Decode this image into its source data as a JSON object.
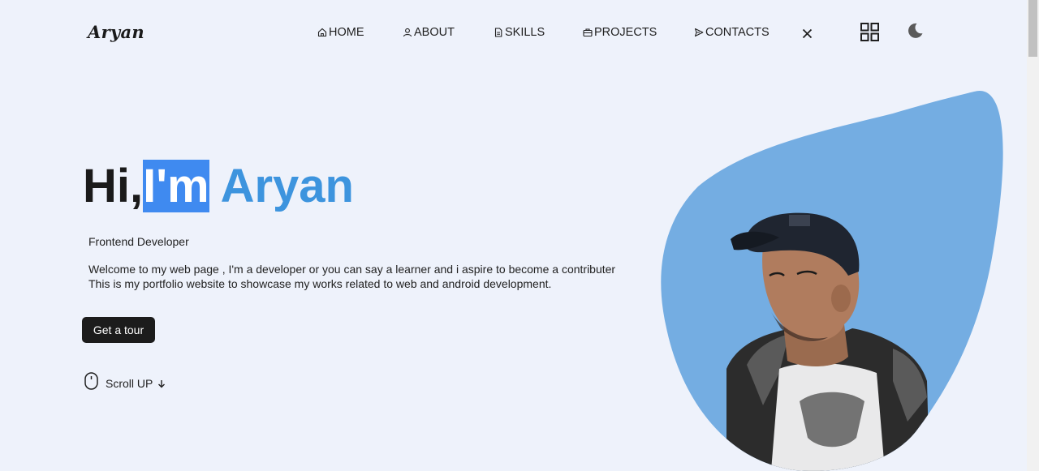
{
  "brand": {
    "logo": "Aryan"
  },
  "nav": {
    "items": [
      {
        "label": "HOME",
        "icon": "home-icon"
      },
      {
        "label": "ABOUT",
        "icon": "user-icon"
      },
      {
        "label": "SKILLS",
        "icon": "file-icon"
      },
      {
        "label": "PROJECTS",
        "icon": "briefcase-icon"
      },
      {
        "label": "CONTACTS",
        "icon": "send-icon"
      }
    ],
    "close_icon": "close-icon",
    "grid_icon": "grid-icon",
    "theme_icon": "moon-icon"
  },
  "hero": {
    "greeting": "Hi,",
    "highlight": "I'm",
    "name": "Aryan",
    "role": "Frontend Developer",
    "description_line1": "Welcome to my web page , I'm a developer or you can say a learner and i aspire to become a contributer",
    "description_line2": "This is my portfolio website to showcase my works related to web and android development.",
    "cta": "Get a tour",
    "scroll_label": "Scroll UP",
    "scroll_icon": "mouse-icon",
    "arrow_icon": "arrow-down-icon"
  },
  "colors": {
    "background": "#eef2fb",
    "accent": "#3d94de",
    "highlight": "#3f8af0",
    "blob": "#74ade2",
    "button": "#1c1c1c"
  }
}
